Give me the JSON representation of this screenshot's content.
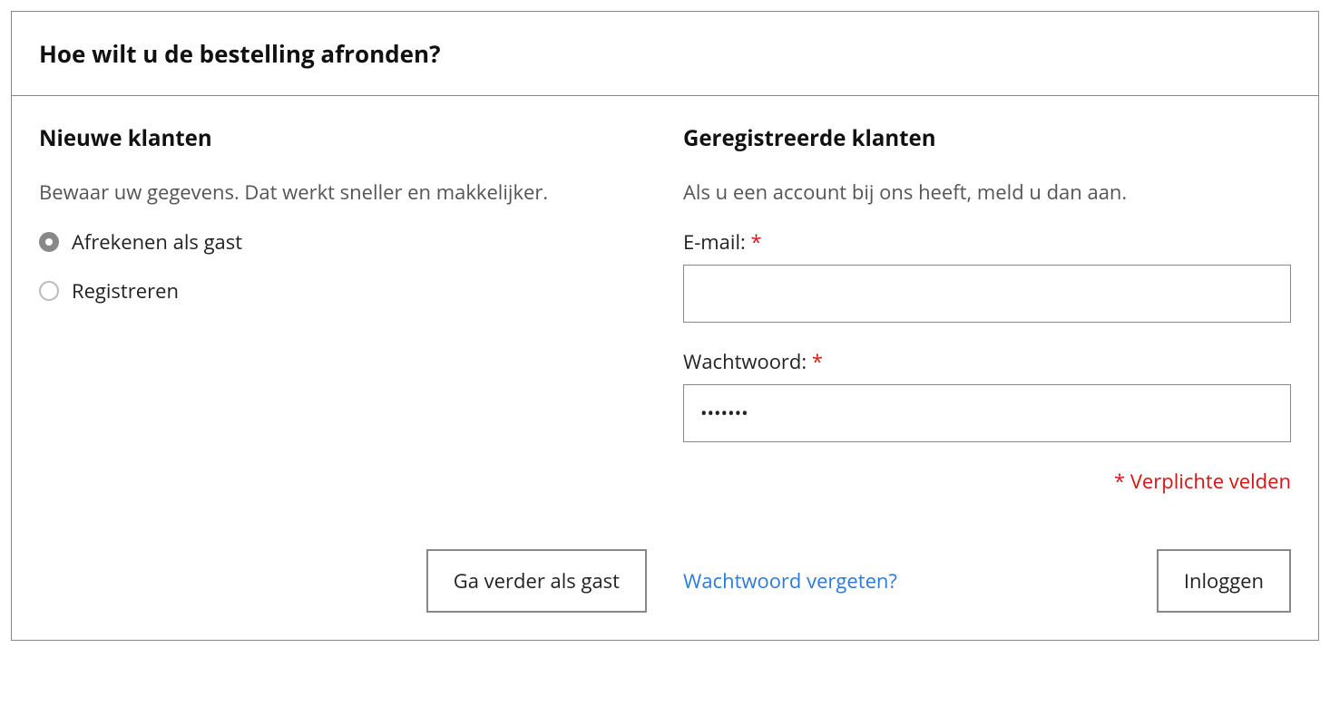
{
  "header": {
    "title": "Hoe wilt u de bestelling afronden?"
  },
  "left": {
    "heading": "Nieuwe klanten",
    "lead": "Bewaar uw gegevens. Dat werkt sneller en makkelijker.",
    "radios": {
      "guest": "Afrekenen als gast",
      "register": "Registreren",
      "selected": "guest"
    },
    "continue_button": "Ga verder als gast"
  },
  "right": {
    "heading": "Geregistreerde klanten",
    "lead": "Als u een account bij ons heeft, meld u dan aan.",
    "email_label": "E-mail:",
    "email_value": "",
    "password_label": "Wachtwoord:",
    "password_value": "•••••••",
    "required_note": "* Verplichte velden",
    "forgot_link": "Wachtwoord vergeten?",
    "login_button": "Inloggen"
  },
  "glyphs": {
    "required": "*"
  }
}
